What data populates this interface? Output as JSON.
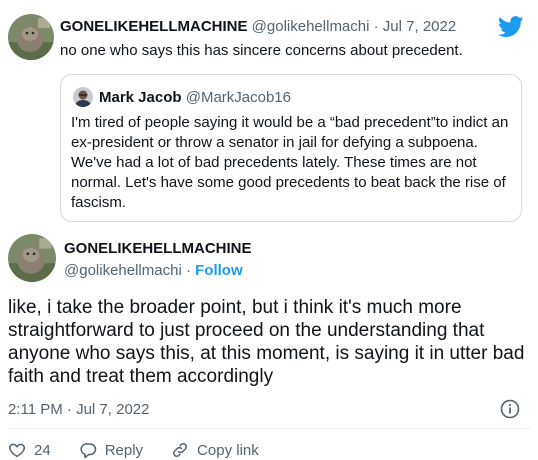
{
  "parent_tweet": {
    "display_name": "GONELIKEHELLMACHINE",
    "handle": "@golikehellmachi",
    "separator": " · ",
    "date": "Jul 7, 2022",
    "text": "no one who says this has sincere concerns about precedent."
  },
  "quoted_tweet": {
    "display_name": "Mark Jacob",
    "handle": "@MarkJacob16",
    "text": "I'm tired of people saying it would be a “bad precedent”to indict an ex-president or throw a senator in jail for defying a subpoena. We've had a lot of bad precedents lately. These times are not normal. Let's have some good precedents to beat back the rise of fascism."
  },
  "main_tweet": {
    "display_name": "GONELIKEHELLMACHINE",
    "handle": "@golikehellmachi",
    "separator": " · ",
    "follow_label": "Follow",
    "text": "like, i take the broader point, but i think it's much more straightforward to just proceed on the understanding that anyone who says this, at this moment, is saying it in utter bad faith and treat them accordingly",
    "timestamp": "2:11 PM · Jul 7, 2022"
  },
  "actions": {
    "like_count": "24",
    "reply_label": "Reply",
    "copy_link_label": "Copy link"
  },
  "icons": {
    "brand": "twitter-bird-icon",
    "info": "info-icon",
    "like": "heart-icon",
    "reply": "reply-icon",
    "copy_link": "link-icon"
  },
  "colors": {
    "brand_blue": "#1d9bf0",
    "text": "#0f1419",
    "muted": "#536471",
    "border": "#cfd9de"
  }
}
